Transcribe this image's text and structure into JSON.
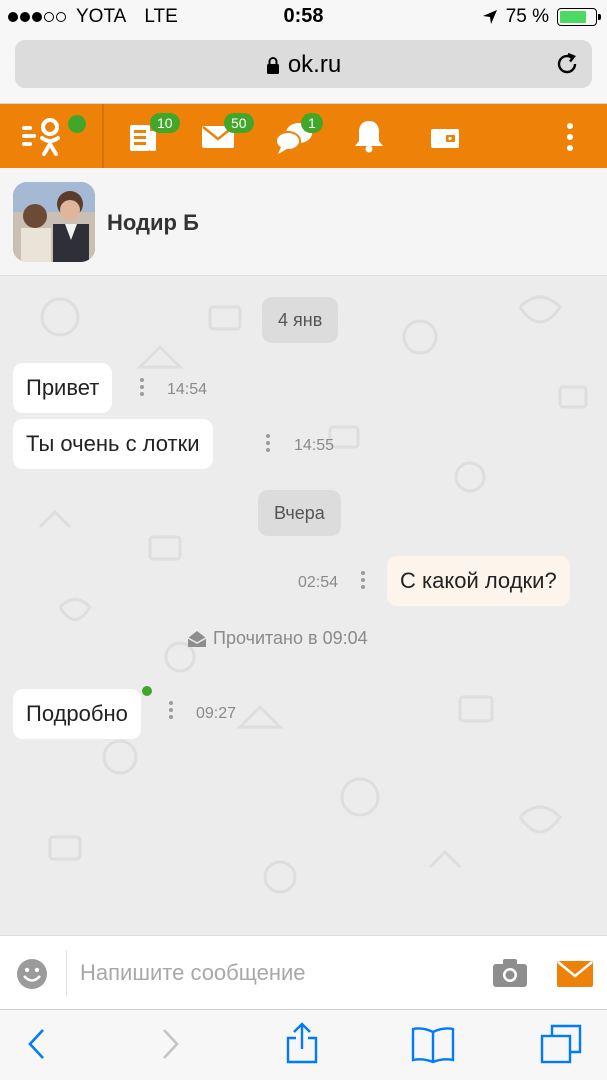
{
  "status_bar": {
    "carrier": "YOTA",
    "network": "LTE",
    "time": "0:58",
    "battery": "75 %",
    "signal_dots": 3,
    "signal_max": 5,
    "battery_level": 0.75
  },
  "browser": {
    "url": "ok.ru"
  },
  "top_nav": {
    "feed_badge": "10",
    "messages_badge": "50",
    "discussions_badge": "1"
  },
  "chat": {
    "peer_name": "Нодир Б",
    "date_1": "4 янв",
    "date_2": "Вчера",
    "read_status": "Прочитано в 09:04",
    "messages": [
      {
        "text": "Привет",
        "time": "14:54",
        "direction": "in"
      },
      {
        "text": "Ты  очень  с лотки",
        "time": "14:55",
        "direction": "in"
      },
      {
        "text": "С какой лодки?",
        "time": "02:54",
        "direction": "out"
      },
      {
        "text": "Подробно",
        "time": "09:27",
        "direction": "in"
      }
    ]
  },
  "composer": {
    "placeholder": "Напишите сообщение"
  },
  "colors": {
    "brand_orange": "#ee8208",
    "badge_green": "#41a62a",
    "ios_blue": "#007aff"
  }
}
